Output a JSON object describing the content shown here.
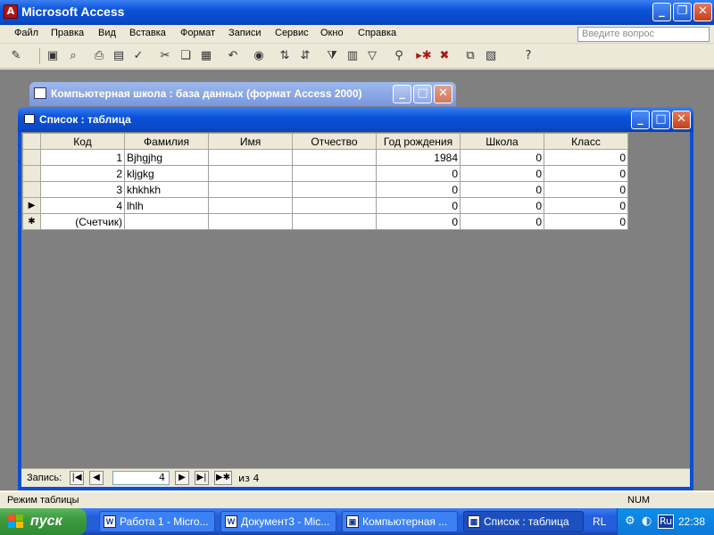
{
  "app": {
    "title": "Microsoft Access",
    "menu": [
      "Файл",
      "Правка",
      "Вид",
      "Вставка",
      "Формат",
      "Записи",
      "Сервис",
      "Окно",
      "Справка"
    ],
    "help_placeholder": "Введите вопрос"
  },
  "db_window": {
    "title": "Компьютерная школа : база данных (формат Access 2000)"
  },
  "table_window": {
    "title": "Список : таблица",
    "columns": [
      "Код",
      "Фамилия",
      "Имя",
      "Отчество",
      "Год рождения",
      "Школа",
      "Класс"
    ],
    "rows": [
      {
        "marker": "",
        "cells": [
          "1",
          "Bjhgjhg",
          "",
          "",
          "1984",
          "0",
          "0"
        ]
      },
      {
        "marker": "",
        "cells": [
          "2",
          "kljgkg",
          "",
          "",
          "0",
          "0",
          "0"
        ]
      },
      {
        "marker": "",
        "cells": [
          "3",
          "khkhkh",
          "",
          "",
          "0",
          "0",
          "0"
        ]
      },
      {
        "marker": "▶",
        "cells": [
          "4",
          "lhlh",
          "",
          "",
          "0",
          "0",
          "0"
        ]
      },
      {
        "marker": "✱",
        "cells": [
          "(Счетчик)",
          "",
          "",
          "",
          "0",
          "0",
          "0"
        ]
      }
    ],
    "nav": {
      "label": "Запись:",
      "current": "4",
      "of_label": "из",
      "total": "4"
    }
  },
  "status": {
    "text": "Режим таблицы",
    "num": "NUM"
  },
  "taskbar": {
    "start": "пуск",
    "tasks": [
      "Работа 1 - Micro...",
      "Документ3 - Mic...",
      "Компьютерная ...",
      "Список : таблица"
    ],
    "lang": "RL",
    "tray_lang": "Ru",
    "clock": "22:38"
  }
}
